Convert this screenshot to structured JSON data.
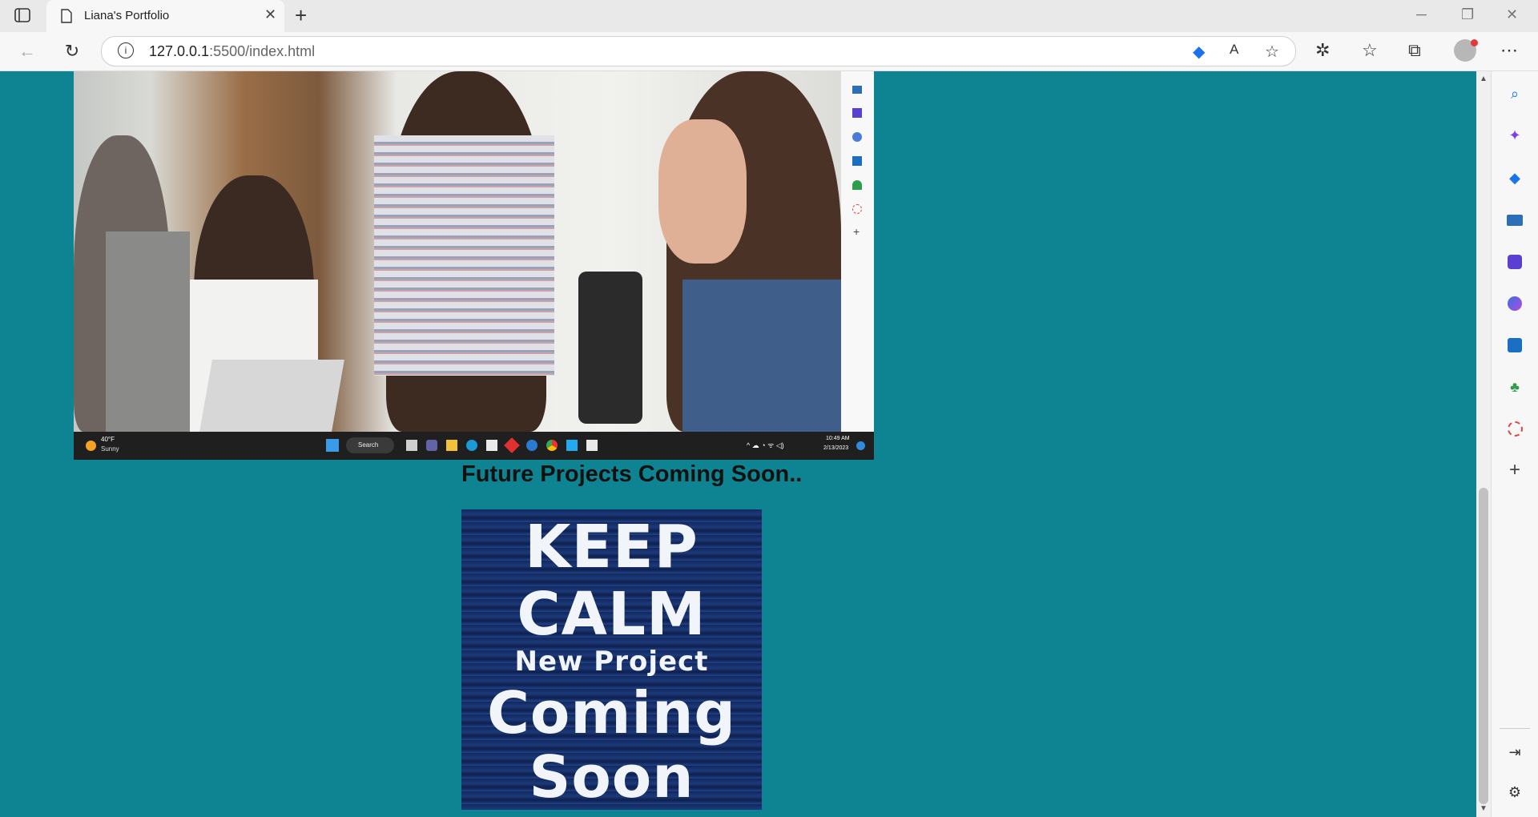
{
  "browser": {
    "tab_title": "Liana's Portfolio",
    "tab_close": "✕",
    "new_tab": "+",
    "url_host": "127.0.0.1",
    "url_rest": ":5500/index.html"
  },
  "page": {
    "heading": "Future Projects Coming Soon..",
    "poster_lines": [
      "KEEP",
      "CALM",
      "New Project",
      "Coming",
      "Soon"
    ],
    "background_color": "#0e8493"
  },
  "screenshot_taskbar": {
    "weather_temp": "40°F",
    "weather_desc": "Sunny",
    "search_label": "Search",
    "time": "10:49 AM",
    "date": "2/13/2023"
  }
}
